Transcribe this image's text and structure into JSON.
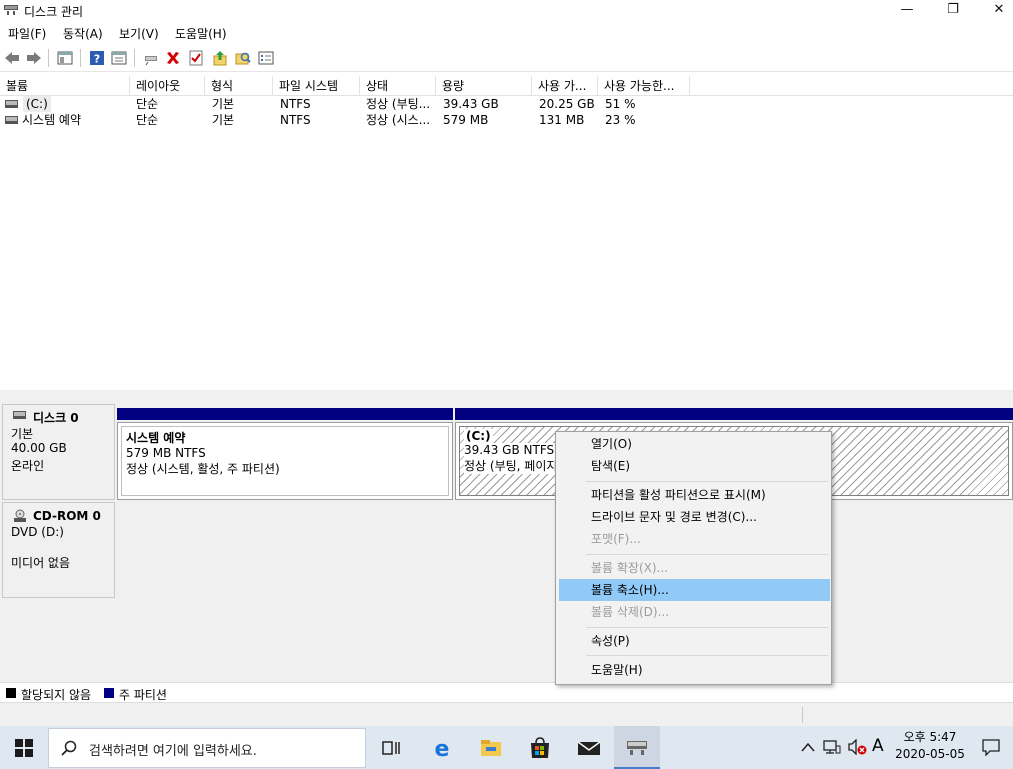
{
  "window": {
    "title": "디스크 관리",
    "minimize_glyph": "—",
    "restore_glyph": "❐",
    "close_glyph": "✕"
  },
  "menu": [
    "파일(F)",
    "동작(A)",
    "보기(V)",
    "도움말(H)"
  ],
  "volume_table": {
    "columns": [
      "볼륨",
      "레이아웃",
      "형식",
      "파일 시스템",
      "상태",
      "용량",
      "사용 가...",
      "사용 가능한..."
    ],
    "rows": [
      [
        "(C:)",
        "단순",
        "기본",
        "NTFS",
        "정상 (부팅...",
        "39.43 GB",
        "20.25 GB",
        "51 %"
      ],
      [
        "시스템 예약",
        "단순",
        "기본",
        "NTFS",
        "정상 (시스...",
        "579 MB",
        "131 MB",
        "23 %"
      ]
    ]
  },
  "disks": [
    {
      "name": "디스크 0",
      "type": "기본",
      "size": "40.00 GB",
      "status": "온라인",
      "partitions": [
        {
          "name": "시스템 예약",
          "size": "579 MB NTFS",
          "status": "정상 (시스템, 활성, 주 파티션)"
        },
        {
          "name": "(C:)",
          "size": "39.43 GB NTFS",
          "status": "정상 (부팅, 페이지"
        }
      ]
    }
  ],
  "cdrom": {
    "name": "CD-ROM 0",
    "type": "DVD (D:)",
    "status": "미디어 없음"
  },
  "legend": [
    {
      "label": "할당되지 않음",
      "color": "#000000"
    },
    {
      "label": "주 파티션",
      "color": "#000080"
    }
  ],
  "context_menu": {
    "items": [
      {
        "label": "열기(O)",
        "enabled": true
      },
      {
        "label": "탐색(E)",
        "enabled": true
      },
      {
        "label": "파티션을 활성 파티션으로 표시(M)",
        "enabled": true
      },
      {
        "label": "드라이브 문자 및 경로 변경(C)...",
        "enabled": true
      },
      {
        "label": "포맷(F)...",
        "enabled": false
      },
      {
        "label": "볼륨 확장(X)...",
        "enabled": false
      },
      {
        "label": "볼륨 축소(H)...",
        "enabled": true,
        "highlighted": true
      },
      {
        "label": "볼륨 삭제(D)...",
        "enabled": false
      },
      {
        "label": "속성(P)",
        "enabled": true
      },
      {
        "label": "도움말(H)",
        "enabled": true
      }
    ]
  },
  "taskbar": {
    "search_placeholder": "검색하려면 여기에 입력하세요.",
    "time": "오후 5:47",
    "date": "2020-05-05",
    "ime": "A"
  },
  "colors": {
    "primary_partition": "#000080",
    "menu_highlight": "#91c9f7",
    "taskbar_bg": "#dfe7f1"
  }
}
